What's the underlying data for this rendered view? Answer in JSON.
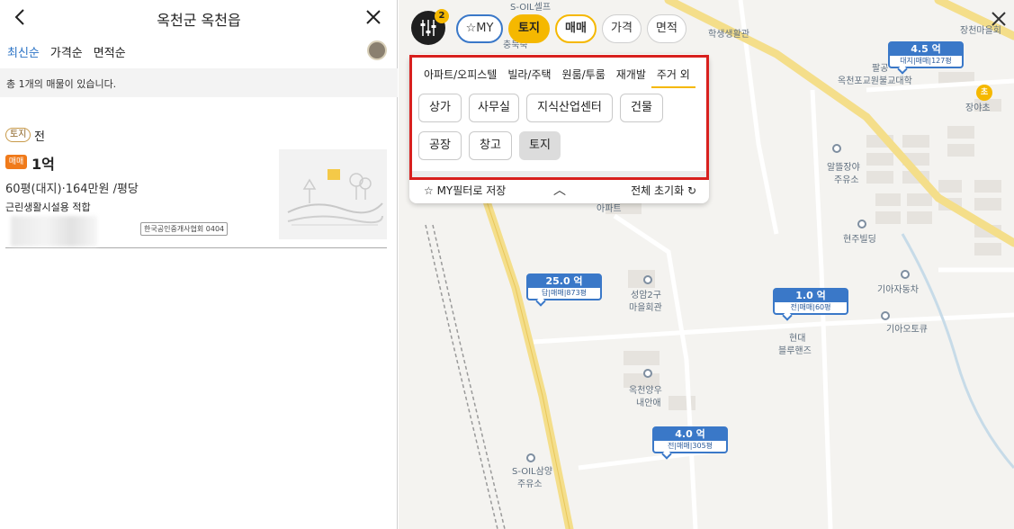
{
  "header": {
    "title": "옥천군 옥천읍"
  },
  "sort_tabs": [
    "최신순",
    "가격순",
    "면적순"
  ],
  "count_text": "총 1개의 매물이 있습니다.",
  "listing": {
    "type_badge": "토지",
    "land_category": "전",
    "deal_badge": "매매",
    "price": "1억",
    "area_text": "60평(대지)·164만원 /평당",
    "note": "근린생활시설용 적합",
    "agency_badge": "한국공인중개사협회 0404"
  },
  "top_bar": {
    "filter_count": "2",
    "chips": [
      "MY",
      "토지",
      "매매",
      "가격",
      "면적"
    ]
  },
  "dropdown": {
    "tabs": [
      "아파트/오피스텔",
      "빌라/주택",
      "원룸/투룸",
      "재개발",
      "주거 외"
    ],
    "active_tab": "주거 외",
    "chips": [
      "상가",
      "사무실",
      "지식산업센터",
      "건물",
      "공장",
      "창고",
      "토지"
    ],
    "selected_chip": "토지",
    "save_label": "MY필터로 저장",
    "reset_label": "전체 초기화"
  },
  "map_labels": {
    "soil_self": "S-OIL셀프",
    "chungbuk": "충북축",
    "student_hall": "학생생활관",
    "jangcheon_hall": "장천마을회",
    "palgong": "팔공",
    "temple": "옥천포교원불교대학",
    "jangya": "장야초",
    "altteul": "알뜰장야",
    "jooyuso": "주유소",
    "apart": "아파트",
    "hyeonju": "현주빌딩",
    "kia_car": "기아자동차",
    "seongam": "성암2구",
    "maeul_hall": "마을회관",
    "kia_auto": "기아오토큐",
    "hyundai": "현대",
    "bluehands": "블루핸즈",
    "okcheon_yangu": "옥천양우",
    "naeanae": "내안애",
    "soil_samyang": "S-OIL삼양",
    "jooyuso2": "주유소"
  },
  "markers": [
    {
      "price": "4.5 억",
      "info": "대지|매매|127평"
    },
    {
      "price": "25.0 억",
      "info": "답|매매|873평"
    },
    {
      "price": "1.0 억",
      "info": "전|매매|60평"
    },
    {
      "price": "4.0 억",
      "info": "전|매매|305평"
    }
  ],
  "colors": {
    "accent_yellow": "#f5b800",
    "marker_blue": "#3a78c8",
    "deal_orange": "#f07a1a",
    "highlight_red": "#d8201e"
  }
}
